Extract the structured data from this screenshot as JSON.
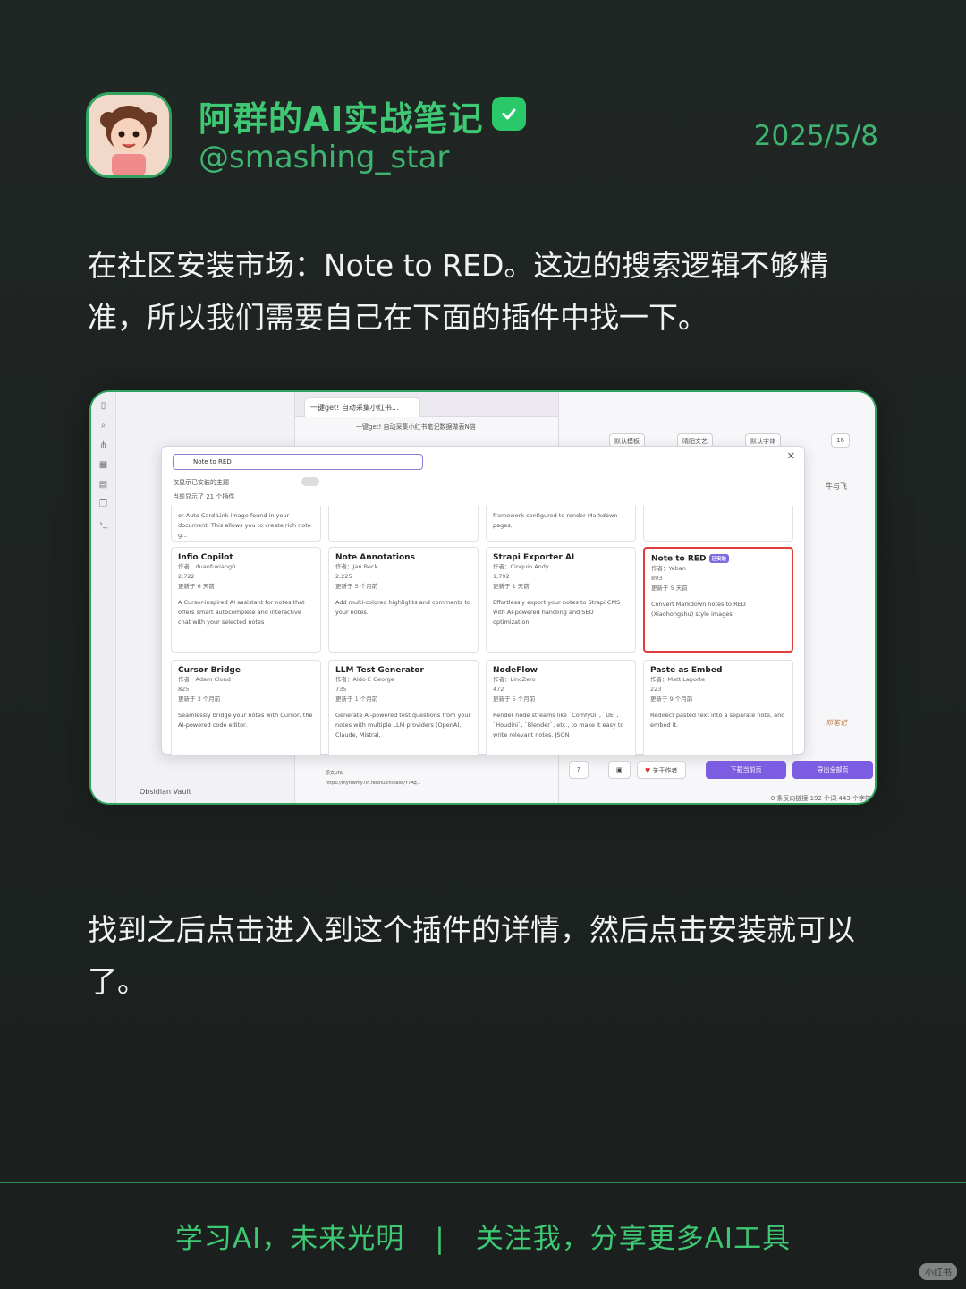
{
  "author": {
    "name": "阿群的AI实战笔记",
    "handle": "@smashing_star",
    "date": "2025/5/8",
    "verified_icon": "check-icon"
  },
  "paragraphs": {
    "intro": "在社区安装市场：Note to RED。这边的搜索逻辑不够精准，所以我们需要自己在下面的插件中找一下。",
    "outro": "找到之后点击进入到这个插件的详情，然后点击安装就可以了。"
  },
  "screenshot": {
    "tab_title": "一键get! 自动采集小红书...",
    "note_title": "一键get! 自动采集小红书笔记数据做表N倍",
    "vault_label": "Obsidian Vault",
    "search_value": "Note to RED",
    "toggle_label": "仅显示已安装的主题",
    "count_label": "当前显示了 21 个插件",
    "toolbar_pills": [
      "默认模板",
      "晴阳文艺",
      "默认字体",
      "16"
    ],
    "side_text": "牛与飞",
    "side_text2": "邓笔记",
    "buttons": {
      "help": "?",
      "image": "▣",
      "about": "关于作者",
      "download": "下载当前页",
      "export": "导出全部页"
    },
    "status": "0 条反向链接   192 个词  443 个字符",
    "url_label": "原文URL",
    "url_value": "https://mytrwmy7in.feishu.cn/base/Y7Aq...",
    "top_partial": [
      "or Auto Card Link image found in your document. This allows you to create rich note g...",
      "",
      "framework configured to render Markdown pages.",
      ""
    ],
    "plugins": [
      {
        "name": "Infio Copilot",
        "author": "作者：duanfuxiang0",
        "downloads": "2,722",
        "updated": "更新于 6 天前",
        "desc": "A Cursor-inspired AI assistant for notes that offers smart autocomplete and interactive chat with your selected notes",
        "installed": ""
      },
      {
        "name": "Note Annotations",
        "author": "作者：Jan Beck",
        "downloads": "2,225",
        "updated": "更新于 5 个月前",
        "desc": "Add multi-colored highlights and comments to your notes.",
        "installed": ""
      },
      {
        "name": "Strapi Exporter AI",
        "author": "作者：Cinquin Andy",
        "downloads": "1,792",
        "updated": "更新于 1 天前",
        "desc": "Effortlessly export your notes to Strapi CMS with AI-powered handling and SEO optimization.",
        "installed": ""
      },
      {
        "name": "Note to RED",
        "author": "作者：Yeban",
        "downloads": "893",
        "updated": "更新于 5 天前",
        "desc": "Convert Markdown notes to RED (Xiaohongshu) style images",
        "installed": "已安装"
      },
      {
        "name": "Cursor Bridge",
        "author": "作者：Adam Cloud",
        "downloads": "825",
        "updated": "更新于 3 个月前",
        "desc": "Seamlessly bridge your notes with Cursor, the AI-powered code editor.",
        "installed": ""
      },
      {
        "name": "LLM Test Generator",
        "author": "作者：Aldo E George",
        "downloads": "735",
        "updated": "更新于 1 个月前",
        "desc": "Generate AI-powered test questions from your notes with multiple LLM providers (OpenAI, Claude, Mistral,",
        "installed": ""
      },
      {
        "name": "NodeFlow",
        "author": "作者：LincZero",
        "downloads": "472",
        "updated": "更新于 5 个月前",
        "desc": "Render node streams like `ComfyUi`, `UE`, `Houdini`, `Blender`, etc., to make it easy to write relevant notes. JSON",
        "installed": ""
      },
      {
        "name": "Paste as Embed",
        "author": "作者：Matt Laporte",
        "downloads": "223",
        "updated": "更新于 9 个月前",
        "desc": "Redirect pasted text into a separate note, and embed it.",
        "installed": ""
      }
    ]
  },
  "footer": {
    "left": "学习AI，未来光明",
    "sep": "|",
    "right": "关注我，分享更多AI工具"
  },
  "watermark": "小红书"
}
